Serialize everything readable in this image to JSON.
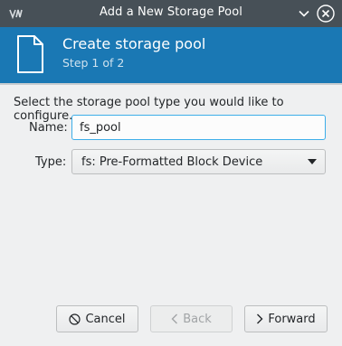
{
  "window": {
    "title": "Add a New Storage Pool"
  },
  "header": {
    "title": "Create storage pool",
    "step": "Step 1 of 2",
    "icon": "document-icon"
  },
  "form": {
    "prompt": "Select the storage pool type you would like to configure.",
    "name_label": "Name:",
    "name_value": "fs_pool",
    "type_label": "Type:",
    "type_value": "fs: Pre-Formatted Block Device"
  },
  "buttons": {
    "cancel": "Cancel",
    "back": "Back",
    "forward": "Forward"
  },
  "colors": {
    "titlebar": "#475057",
    "header": "#1a78b4",
    "focus": "#3daee9",
    "background": "#eff0f1"
  }
}
